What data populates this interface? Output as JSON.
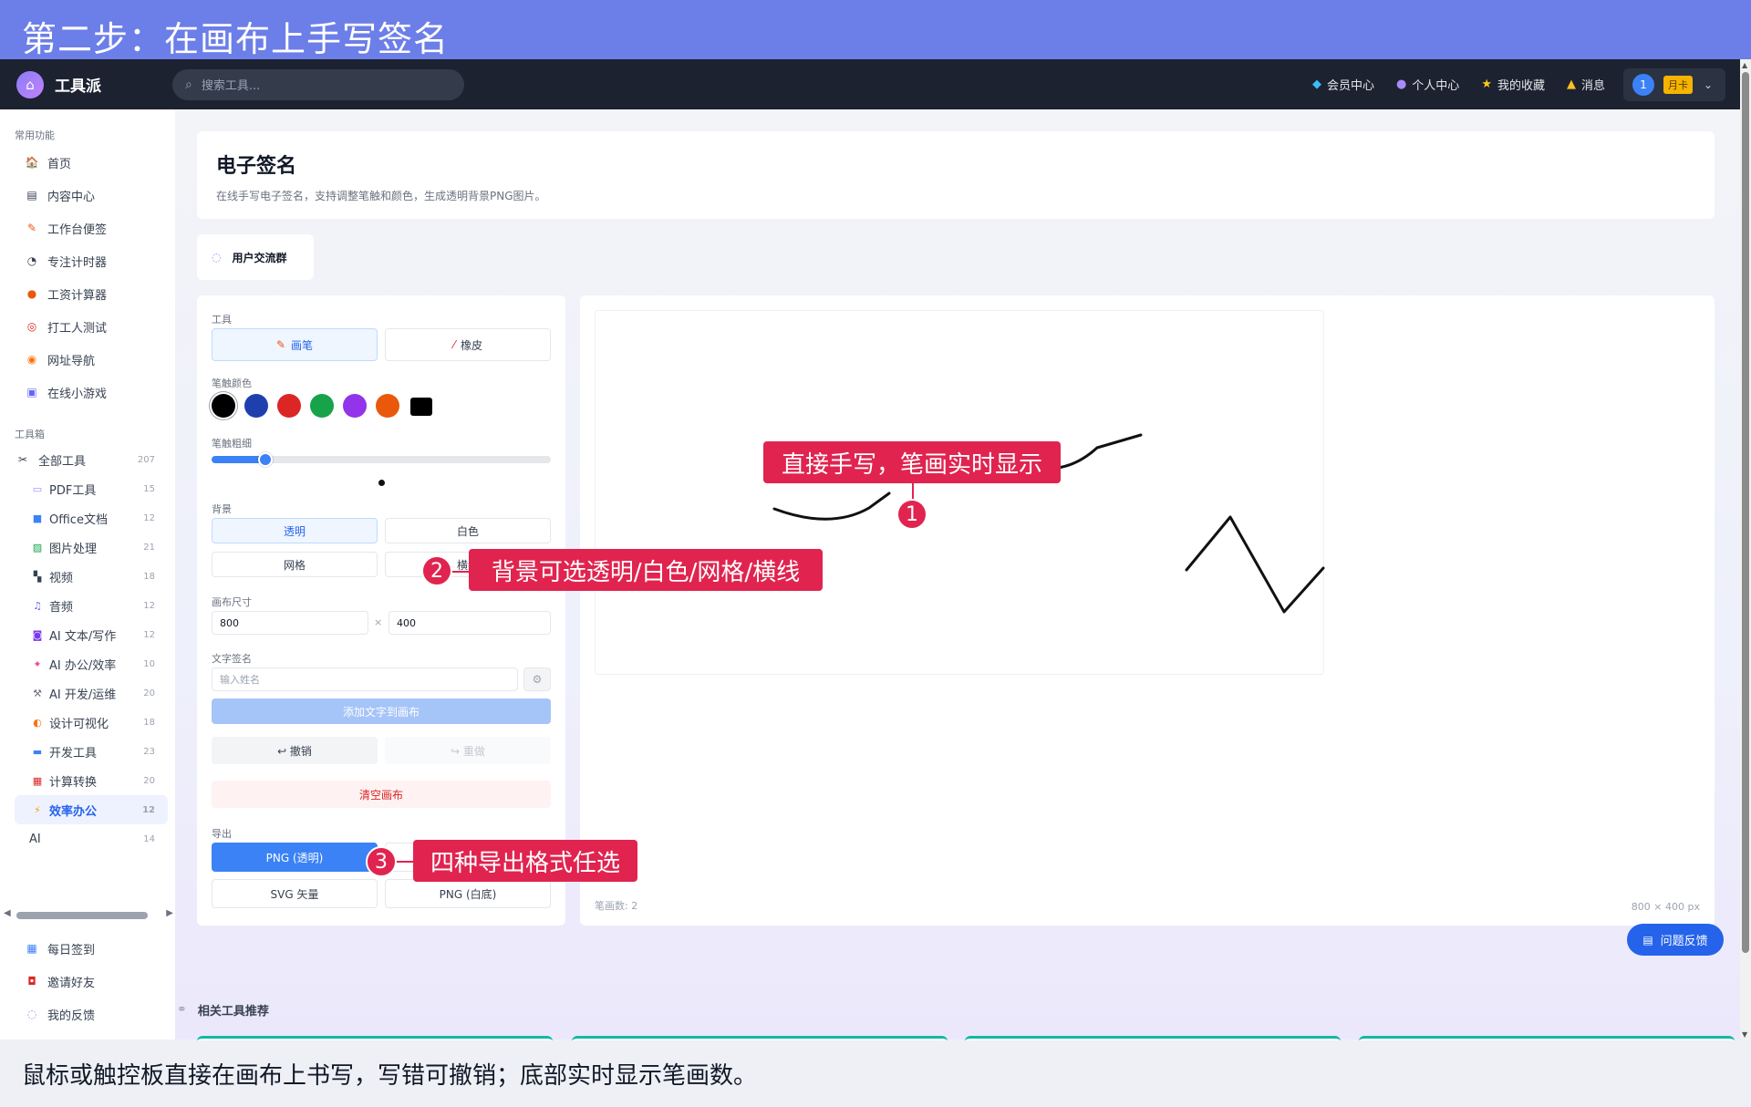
{
  "banner": "第二步：在画布上手写签名",
  "caption": "鼠标或触控板直接在画布上书写，写错可撤销；底部实时显示笔画数。",
  "header": {
    "logo": "工具派",
    "search_placeholder": "搜索工具...",
    "nav": [
      "会员中心",
      "个人中心",
      "我的收藏",
      "消息"
    ],
    "user_avatar": "1",
    "user_tag": "月卡"
  },
  "sidebar": {
    "section_common": "常用功能",
    "common": [
      "首页",
      "内容中心",
      "工作台便签",
      "专注计时器",
      "工资计算器",
      "打工人测试",
      "网址导航",
      "在线小游戏"
    ],
    "section_tools": "工具箱",
    "all_tools": {
      "label": "全部工具",
      "count": "207"
    },
    "categories": [
      {
        "label": "PDF工具",
        "count": "15"
      },
      {
        "label": "Office文档",
        "count": "12"
      },
      {
        "label": "图片处理",
        "count": "21"
      },
      {
        "label": "视频",
        "count": "18"
      },
      {
        "label": "音频",
        "count": "12"
      },
      {
        "label": "AI 文本/写作",
        "count": "12"
      },
      {
        "label": "AI 办公/效率",
        "count": "10"
      },
      {
        "label": "AI 开发/运维",
        "count": "20"
      },
      {
        "label": "设计可视化",
        "count": "18"
      },
      {
        "label": "开发工具",
        "count": "23"
      },
      {
        "label": "计算转换",
        "count": "20"
      },
      {
        "label": "效率办公",
        "count": "12"
      },
      {
        "label": "AI",
        "count": "14"
      }
    ],
    "bottom": [
      "每日签到",
      "邀请好友",
      "我的反馈"
    ]
  },
  "page": {
    "title": "电子签名",
    "subtitle": "在线手写电子签名，支持调整笔触和颜色，生成透明背景PNG图片。",
    "group_button": "用户交流群"
  },
  "panel": {
    "tool_label": "工具",
    "pen": "画笔",
    "eraser": "橡皮",
    "color_label": "笔触颜色",
    "colors": [
      "#000000",
      "#1e40af",
      "#dc2626",
      "#16a34a",
      "#9333ea",
      "#ea580c",
      "#000000"
    ],
    "thickness_label": "笔触粗细",
    "thickness_fraction": 0.14,
    "bg_label": "背景",
    "bg_options": [
      "透明",
      "白色",
      "网格",
      "横线"
    ],
    "size_label": "画布尺寸",
    "width": "800",
    "height": "400",
    "times": "×",
    "text_sig_label": "文字签名",
    "name_placeholder": "输入姓名",
    "add_text": "添加文字到画布",
    "undo": "↩ 撤销",
    "redo": "↪ 重做",
    "clear": "清空画布",
    "export_label": "导出",
    "exports": [
      "PNG (透明)",
      "",
      "SVG 矢量",
      "PNG (白底)"
    ]
  },
  "canvas": {
    "stroke_count": "笔画数: 2",
    "size": "800 × 400 px"
  },
  "callouts": [
    {
      "num": "1",
      "text": "直接手写，笔画实时显示"
    },
    {
      "num": "2",
      "text": "背景可选透明/白色/网格/横线"
    },
    {
      "num": "3",
      "text": "四种导出格式任选"
    }
  ],
  "feedback": "问题反馈",
  "related": "相关工具推荐",
  "colors": {
    "accent": "#3b82f6",
    "callout": "#e0244f",
    "banner": "#6c7ee8",
    "topbar": "#1c2230"
  }
}
